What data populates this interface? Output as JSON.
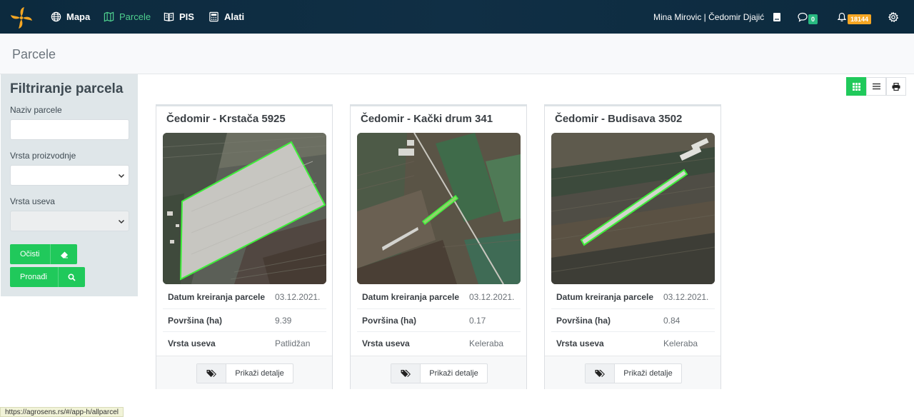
{
  "nav": {
    "items": [
      {
        "label": "Mapa",
        "icon": "globe-icon"
      },
      {
        "label": "Parcele",
        "icon": "map-icon"
      },
      {
        "label": "PIS",
        "icon": "book-icon"
      },
      {
        "label": "Alati",
        "icon": "calculator-icon"
      }
    ],
    "user": "Mina Mirovic | Čedomir Djajić",
    "messages_badge": "0",
    "notifications_badge": "18144",
    "colors": {
      "active": "#4ecf8e",
      "messages_badge": "#28b981",
      "notifications_badge": "#f5a623",
      "primary_button": "#20c95b"
    }
  },
  "page": {
    "title": "Parcele"
  },
  "filter": {
    "title": "Filtriranje parcela",
    "name_label": "Naziv parcele",
    "name_value": "",
    "production_label": "Vrsta proizvodnje",
    "production_value": "",
    "crop_label": "Vrsta useva",
    "crop_value": "",
    "clear_label": "Očisti",
    "find_label": "Pronađi"
  },
  "view": {
    "grid": "grid-icon",
    "list": "list-icon",
    "print": "print-icon",
    "active": "grid"
  },
  "cards": [
    {
      "title": "Čedomir - Krstača 5925",
      "rows": [
        {
          "key": "Datum kreiranja parcele",
          "value": "03.12.2021."
        },
        {
          "key": "Površina (ha)",
          "value": "9.39"
        },
        {
          "key": "Vrsta useva",
          "value": "Patlidžan"
        }
      ],
      "button": "Prikaži detalje"
    },
    {
      "title": "Čedomir - Kački drum 341",
      "rows": [
        {
          "key": "Datum kreiranja parcele",
          "value": "03.12.2021."
        },
        {
          "key": "Površina (ha)",
          "value": "0.17"
        },
        {
          "key": "Vrsta useva",
          "value": "Keleraba"
        }
      ],
      "button": "Prikaži detalje"
    },
    {
      "title": "Čedomir - Budisava 3502",
      "rows": [
        {
          "key": "Datum kreiranja parcele",
          "value": "03.12.2021."
        },
        {
          "key": "Površina (ha)",
          "value": "0.84"
        },
        {
          "key": "Vrsta useva",
          "value": "Keleraba"
        }
      ],
      "button": "Prikaži detalje"
    }
  ],
  "status_url": "https://agrosens.rs/#/app-h/allparcel"
}
